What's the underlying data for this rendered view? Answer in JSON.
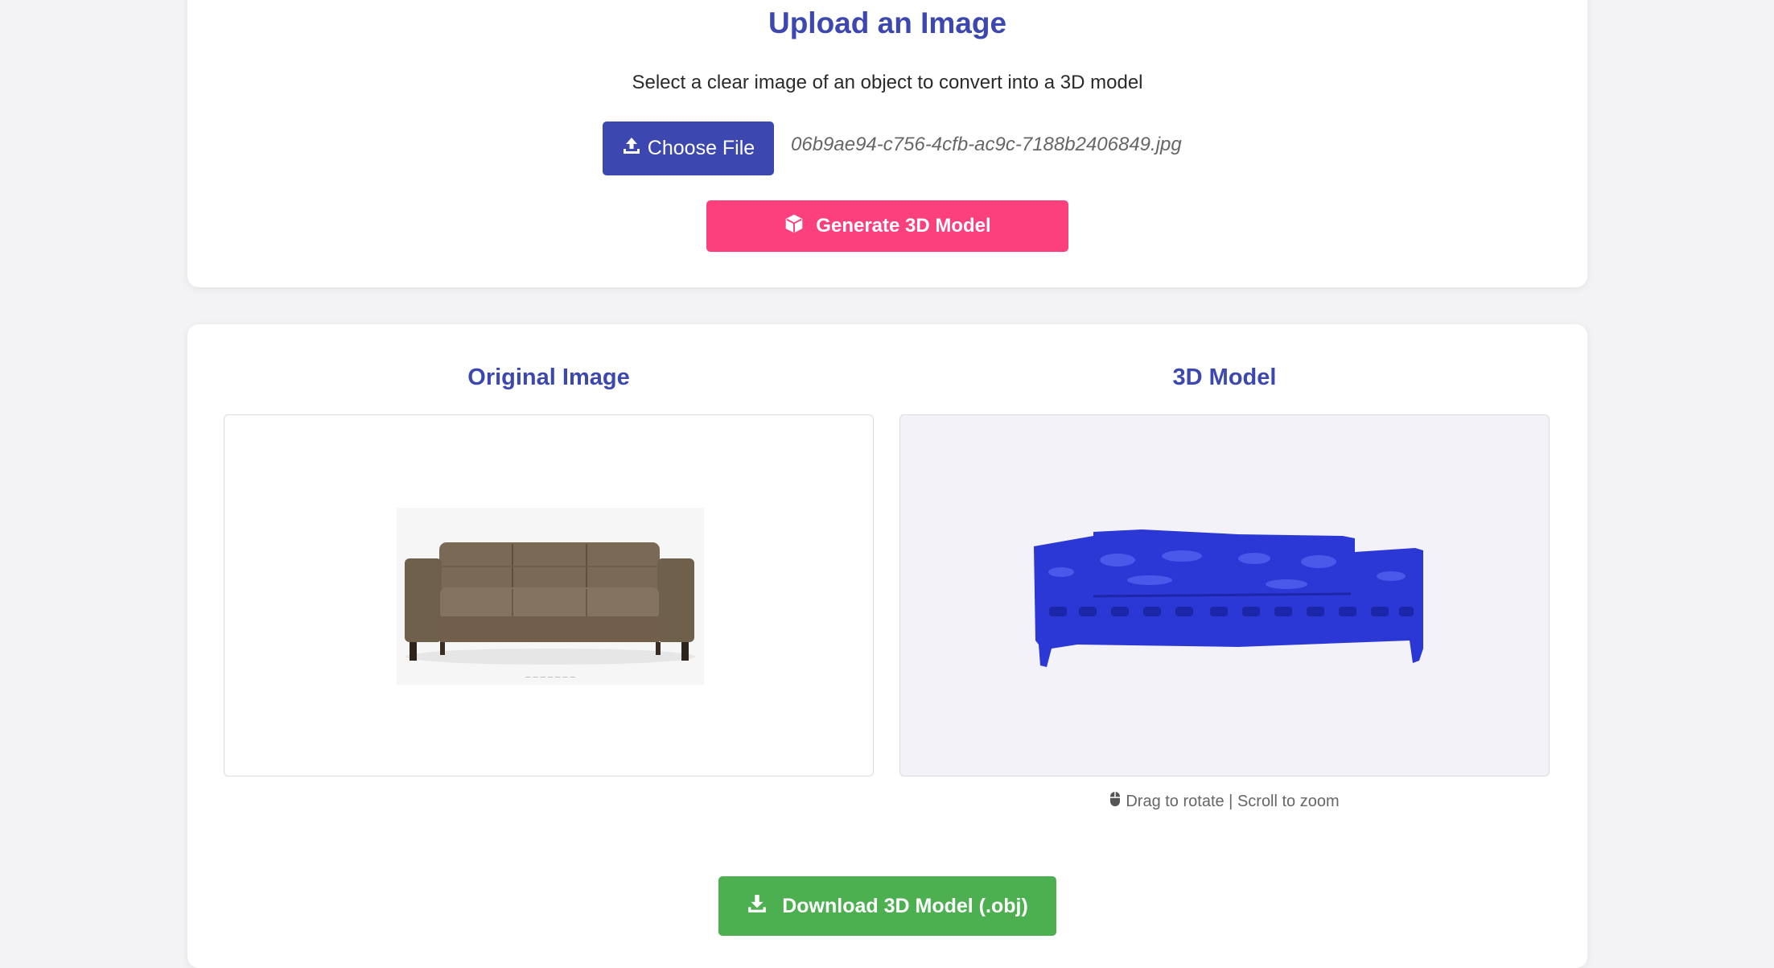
{
  "upload": {
    "title": "Upload an Image",
    "subtitle": "Select a clear image of an object to convert into a 3D model",
    "choose_button": "Choose File",
    "file_name": "06b9ae94-c756-4cfb-ac9c-7188b2406849.jpg",
    "generate_button": "Generate 3D Model"
  },
  "result": {
    "original_title": "Original Image",
    "model_title": "3D Model",
    "hint": "Drag to rotate | Scroll to zoom",
    "download_button": "Download 3D Model (.obj)"
  },
  "colors": {
    "accent": "#3c48b0",
    "generate": "#fb407d",
    "download": "#4caf50",
    "model": "#2b38d6"
  },
  "icons": {
    "choose": "upload-icon",
    "generate": "cube-icon",
    "hint": "mouse-icon",
    "download": "download-icon"
  }
}
